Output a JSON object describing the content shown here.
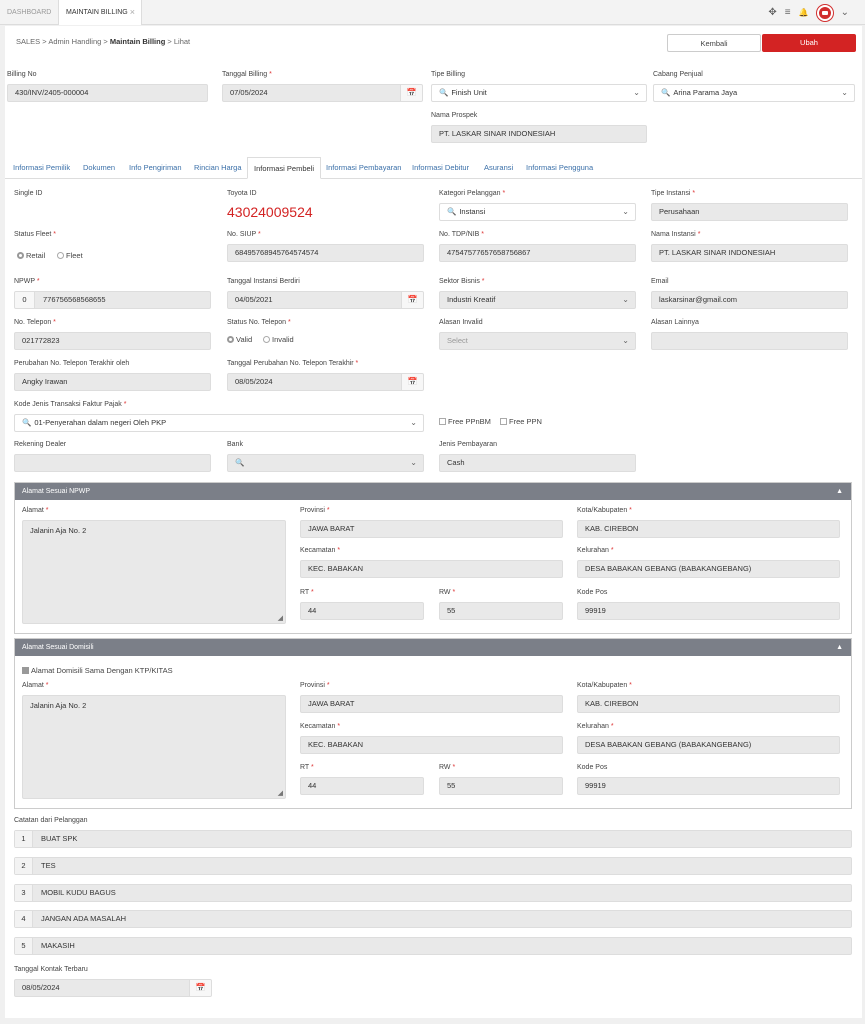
{
  "tabs": {
    "dashboard": "DASHBOARD",
    "maintain_billing": "MAINTAIN BILLING",
    "close": "×"
  },
  "topbar": {
    "expand_icon": "✥",
    "menu_icon": "≡",
    "bell_icon": "🔔",
    "chevron": "⌄"
  },
  "breadcrumb": {
    "sales": "SALES",
    "admin": "Admin Handling",
    "maintain": "Maintain Billing",
    "lihat": "Lihat",
    "sep": ">"
  },
  "actions": {
    "kembali": "Kembali",
    "ubah": "Ubah"
  },
  "header": {
    "billing_no_label": "Billing No",
    "billing_no": "430/INV/2405-000004",
    "tgl_billing_label": "Tanggal Billing",
    "tgl_billing": "07/05/2024",
    "tipe_billing_label": "Tipe Billing",
    "tipe_billing": "Finish Unit",
    "cabang_label": "Cabang Penjual",
    "cabang": "Arina Parama Jaya",
    "prospek_label": "Nama Prospek",
    "prospek": "PT. LASKAR SINAR INDONESIAH"
  },
  "nav_tabs": [
    "Informasi Pemilik",
    "Dokumen",
    "Info Pengiriman",
    "Rincian Harga",
    "Informasi Pembeli",
    "Informasi Pembayaran",
    "Informasi Debitur",
    "Asuransi",
    "Informasi Pengguna"
  ],
  "buyer": {
    "single_id_label": "Single ID",
    "toyota_id_label": "Toyota ID",
    "toyota_id": "43024009524",
    "kategori_label": "Kategori Pelanggan",
    "kategori": "Instansi",
    "tipe_instansi_label": "Tipe Instansi",
    "tipe_instansi": "Perusahaan",
    "status_fleet_label": "Status Fleet",
    "retail": "Retail",
    "fleet": "Fleet",
    "siup_label": "No. SIUP",
    "siup": "68495768945764574574",
    "tdp_label": "No. TDP/NIB",
    "tdp": "47547577657658756867",
    "nama_instansi_label": "Nama Instansi",
    "nama_instansi": "PT. LASKAR SINAR INDONESIAH",
    "npwp_label": "NPWP",
    "npwp_prefix": "0",
    "npwp": "776756568568655",
    "tgl_berdiri_label": "Tanggal Instansi Berdiri",
    "tgl_berdiri": "04/05/2021",
    "sektor_label": "Sektor Bisnis",
    "sektor": "Industri Kreatif",
    "email_label": "Email",
    "email": "laskarsinar@gmail.com",
    "telp_label": "No. Telepon",
    "telp": "021772823",
    "status_telp_label": "Status No. Telepon",
    "valid": "Valid",
    "invalid": "Invalid",
    "alasan_invalid_label": "Alasan Invalid",
    "alasan_invalid_ph": "Select",
    "alasan_lain_label": "Alasan Lainnya",
    "perubahan_oleh_label": "Perubahan No. Telepon Terakhir oleh",
    "perubahan_oleh": "Angky Irawan",
    "tgl_perubahan_label": "Tanggal Perubahan No. Telepon Terakhir",
    "tgl_perubahan": "08/05/2024",
    "kode_faktur_label": "Kode Jenis Transaksi Faktur Pajak",
    "kode_faktur": "01-Penyerahan dalam negeri Oleh PKP",
    "free_ppnbm": "Free PPnBM",
    "free_ppn": "Free PPN",
    "rekening_label": "Rekening Dealer",
    "bank_label": "Bank",
    "jenis_bayar_label": "Jenis Pembayaran",
    "jenis_bayar": "Cash"
  },
  "addr_npwp": {
    "title": "Alamat Sesuai NPWP",
    "alamat_label": "Alamat",
    "alamat": "Jalanin Aja No. 2",
    "provinsi_label": "Provinsi",
    "provinsi": "JAWA BARAT",
    "kota_label": "Kota/Kabupaten",
    "kota": "KAB. CIREBON",
    "kec_label": "Kecamatan",
    "kec": "KEC. BABAKAN",
    "kel_label": "Kelurahan",
    "kel": "DESA BABAKAN GEBANG (BABAKANGEBANG)",
    "rt_label": "RT",
    "rt": "44",
    "rw_label": "RW",
    "rw": "55",
    "kodepos_label": "Kode Pos",
    "kodepos": "99919"
  },
  "addr_dom": {
    "title": "Alamat Sesuai Domisili",
    "same_label": "Alamat Domisili Sama Dengan KTP/KITAS",
    "alamat_label": "Alamat",
    "alamat": "Jalanin Aja No. 2",
    "provinsi_label": "Provinsi",
    "provinsi": "JAWA BARAT",
    "kota_label": "Kota/Kabupaten",
    "kota": "KAB. CIREBON",
    "kec_label": "Kecamatan",
    "kec": "KEC. BABAKAN",
    "kel_label": "Kelurahan",
    "kel": "DESA BABAKAN GEBANG (BABAKANGEBANG)",
    "rt_label": "RT",
    "rt": "44",
    "rw_label": "RW",
    "rw": "55",
    "kodepos_label": "Kode Pos",
    "kodepos": "99919"
  },
  "catatan": {
    "label": "Catatan dari Pelanggan",
    "items": [
      {
        "n": "1",
        "text": "BUAT SPK"
      },
      {
        "n": "2",
        "text": "TES"
      },
      {
        "n": "3",
        "text": "MOBIL KUDU BAGUS"
      },
      {
        "n": "4",
        "text": "JANGAN ADA MASALAH"
      },
      {
        "n": "5",
        "text": "MAKASIH"
      }
    ]
  },
  "kontak": {
    "label": "Tanggal Kontak Terbaru",
    "value": "08/05/2024"
  },
  "icons": {
    "calendar": "📅",
    "search": "🔍",
    "chevron": "⌄",
    "caret_up": "▲",
    "grip": "◢"
  }
}
